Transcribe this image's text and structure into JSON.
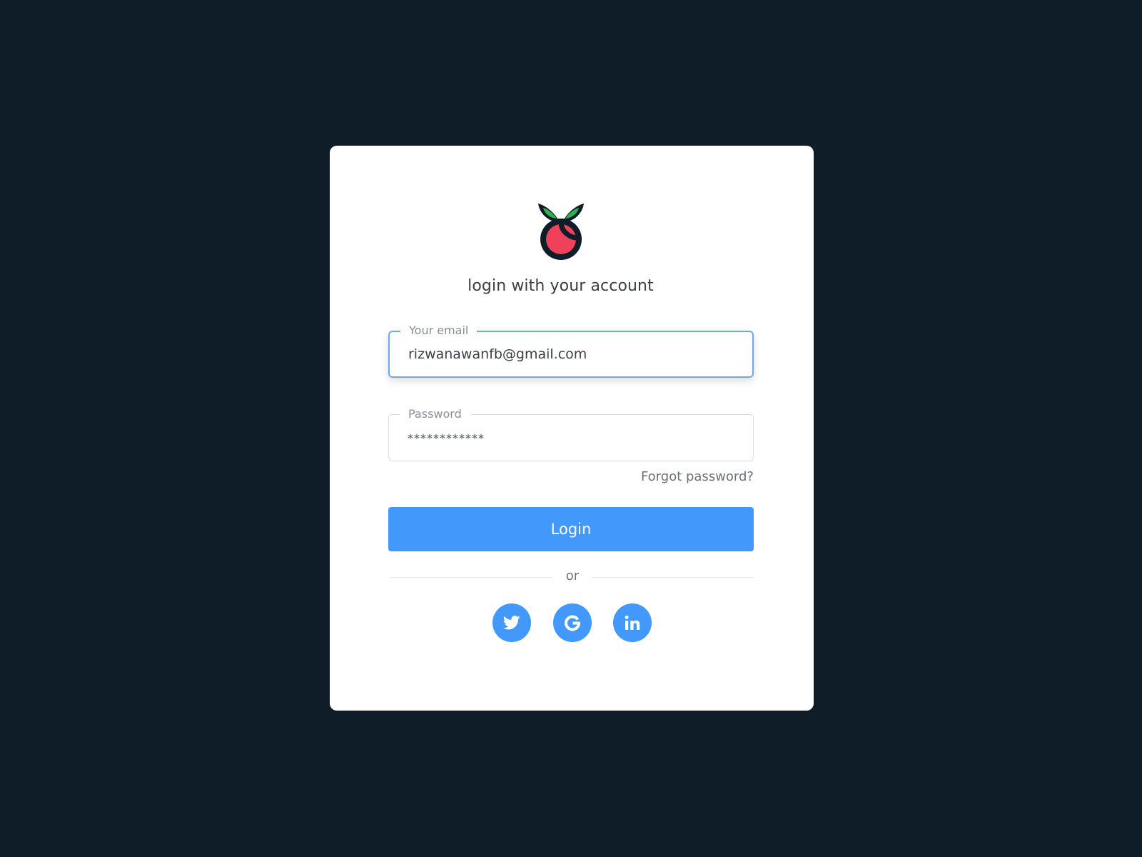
{
  "login_card": {
    "heading": "login with your account",
    "email": {
      "label": "Your email",
      "value": "rizwanawanfb@gmail.com"
    },
    "password": {
      "label": "Password",
      "value": "************"
    },
    "forgot_password": "Forgot password?",
    "login_button": "Login",
    "divider_text": "or",
    "social_buttons": [
      {
        "icon": "twitter-icon"
      },
      {
        "icon": "google-icon"
      },
      {
        "icon": "linkedin-icon"
      }
    ]
  },
  "colors": {
    "background": "#0e1d28",
    "card": "#ffffff",
    "accent": "#4299fb",
    "logo_fruit": "#f0415a",
    "logo_leaf": "#2bb24c",
    "logo_outline": "#0e1d28"
  }
}
